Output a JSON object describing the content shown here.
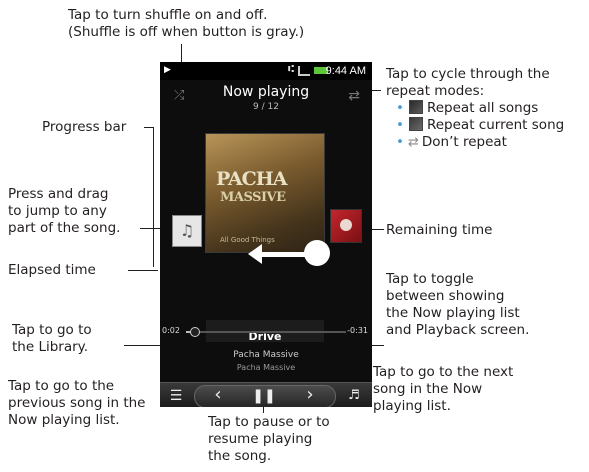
{
  "annotations": {
    "shuffle": [
      "Tap to turn shuffle on and off.",
      "(Shuffle is off when button is gray.)"
    ],
    "repeat": [
      "Tap to cycle through the",
      "repeat modes:"
    ],
    "repeat_modes": [
      "Repeat all songs",
      "Repeat current song",
      "Don’t repeat"
    ],
    "progress_bar": "Progress bar",
    "press_drag": [
      "Press and drag",
      "to jump to any",
      "part of the song."
    ],
    "remaining_time": "Remaining time",
    "elapsed_time": "Elapsed time",
    "toggle": [
      "Tap to toggle",
      "between showing",
      "the Now playing list",
      "and Playback screen."
    ],
    "library": [
      "Tap to go to",
      "the Library."
    ],
    "previous": [
      "Tap to go to the",
      "previous song in the",
      "Now playing list."
    ],
    "pause": [
      "Tap to pause or to",
      "resume playing",
      "the song."
    ],
    "next": [
      "Tap to go to the next",
      "song in the Now",
      "playing list."
    ]
  },
  "phone": {
    "status": {
      "time": "9:44 AM"
    },
    "title": "Now playing",
    "count": "9 / 12",
    "album_art_text": {
      "line1": "PACHA",
      "line2": "MASSIVE",
      "line3": "All Good Things"
    },
    "song": "Drive",
    "artist": "Pacha Massive",
    "album": "Pacha Massive",
    "elapsed": "0:02",
    "remaining": "-0:31",
    "progress_fraction": 0.05
  },
  "icons": {
    "shuffle": "shuffle-icon",
    "repeat": "repeat-icon",
    "library": "menu-list-icon",
    "previous": "previous-icon",
    "pause": "pause-icon",
    "next": "next-icon",
    "toggle": "playlist-toggle-icon"
  },
  "colors": {
    "phone_bg": "#0d0d0d",
    "battery": "#5dc63a",
    "bullet": "#4a9bd7"
  }
}
